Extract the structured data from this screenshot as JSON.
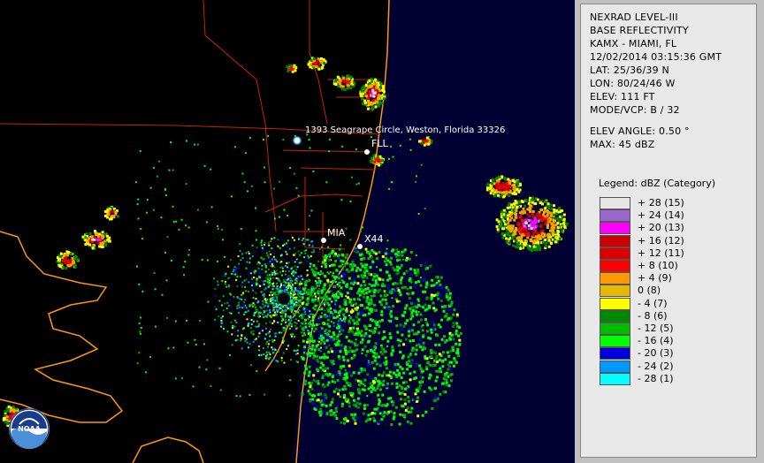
{
  "info": {
    "product": "NEXRAD LEVEL-III",
    "type": "BASE REFLECTIVITY",
    "station": "KAMX - MIAMI, FL",
    "datetime": "12/02/2014 03:15:36 GMT",
    "lat": "LAT: 25/36/39 N",
    "lon": "LON: 80/24/46 W",
    "elev": "ELEV: 111 FT",
    "mode": "MODE/VCP: B / 32",
    "elev_angle": "ELEV ANGLE: 0.50 °",
    "max": "MAX: 45 dBZ"
  },
  "legend": {
    "title": "Legend: dBZ (Category)",
    "items": [
      {
        "label": "+ 28  (15)",
        "color": "#e6e6e6"
      },
      {
        "label": "+ 24  (14)",
        "color": "#9966cc"
      },
      {
        "label": "+ 20  (13)",
        "color": "#ff00ff"
      },
      {
        "label": "+ 16  (12)",
        "color": "#cc0000"
      },
      {
        "label": "+ 12  (11)",
        "color": "#dd0000"
      },
      {
        "label": "+ 8  (10)",
        "color": "#ff0000"
      },
      {
        "label": "+ 4  (9)",
        "color": "#ff9900"
      },
      {
        "label": "0  (8)",
        "color": "#e6b800"
      },
      {
        "label": "- 4  (7)",
        "color": "#ffff00"
      },
      {
        "label": "- 8  (6)",
        "color": "#008800"
      },
      {
        "label": "- 12  (5)",
        "color": "#00bb00"
      },
      {
        "label": "- 16  (4)",
        "color": "#00ff00"
      },
      {
        "label": "- 20  (3)",
        "color": "#0000dd"
      },
      {
        "label": "- 24  (2)",
        "color": "#0099ff"
      },
      {
        "label": "- 28  (1)",
        "color": "#00ffff"
      }
    ]
  },
  "map": {
    "address_label": "1393 Seagrape Circle, Weston, Florida 33326",
    "places": [
      {
        "name": "FLL"
      },
      {
        "name": "MIA"
      },
      {
        "name": "X44"
      }
    ],
    "logo_text": "NOAA"
  },
  "colors": {
    "ocean": "#000033",
    "land": "#000000",
    "coastline": "#ff9900",
    "roads": "#cc0000"
  }
}
